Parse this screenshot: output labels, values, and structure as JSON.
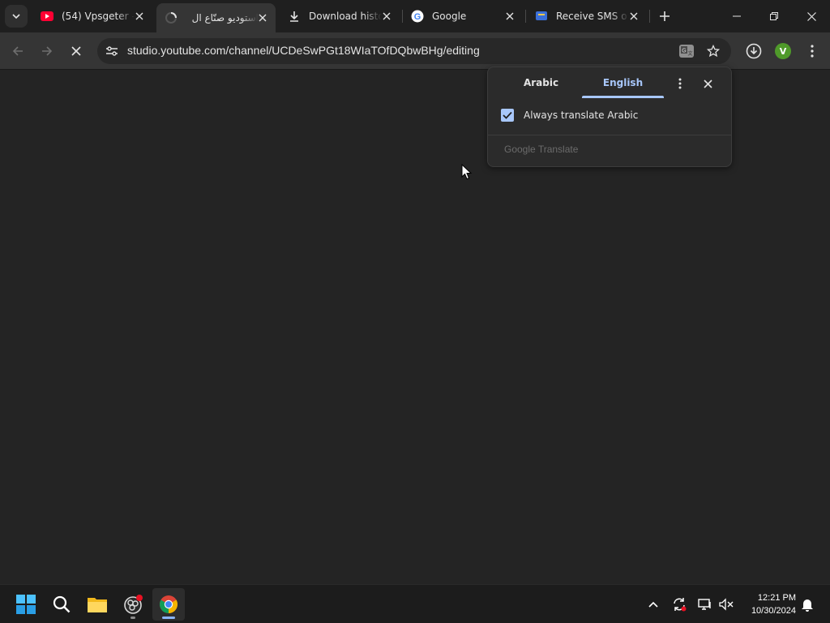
{
  "tabs": [
    {
      "title": "(54) Vpsgeter -",
      "favicon": "youtube-icon"
    },
    {
      "title": "استوديو صنّاع ال",
      "favicon": "loading-icon",
      "active": true
    },
    {
      "title": "Download histo",
      "favicon": "download-icon"
    },
    {
      "title": "Google",
      "favicon": "google-icon"
    },
    {
      "title": "Receive SMS o",
      "favicon": "sms-site-icon"
    }
  ],
  "omnibox": {
    "url": "studio.youtube.com/channel/UCDeSwPGt18WIaTOfDQbwBHg/editing"
  },
  "profile": {
    "initial": "V",
    "color": "#4f9a2a"
  },
  "translate_bubble": {
    "source_language": "Arabic",
    "target_language": "English",
    "selected": "English",
    "always_translate_label": "Always translate Arabic",
    "always_translate_checked": true,
    "footer": "Google Translate"
  },
  "taskbar": {
    "time": "12:21 PM",
    "date": "10/30/2024"
  },
  "colors": {
    "accent": "#a8c7fa",
    "background": "#242424"
  }
}
